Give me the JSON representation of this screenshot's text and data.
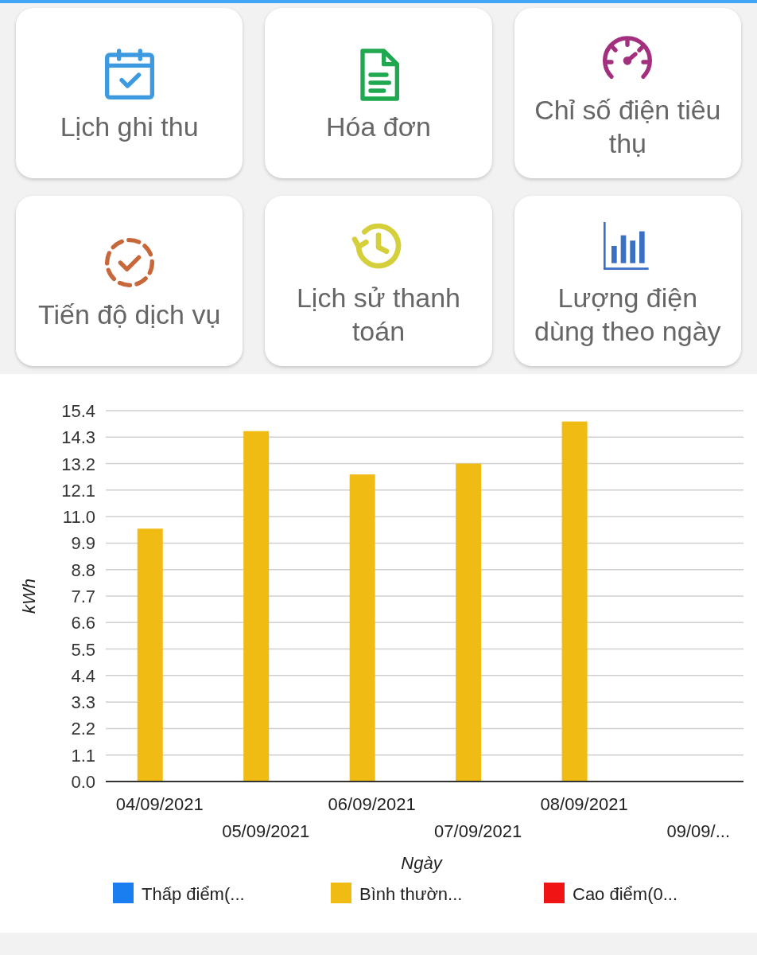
{
  "tiles": [
    {
      "label": "Lịch ghi thu",
      "kind": "calendar",
      "color": "#3d9ae0"
    },
    {
      "label": "Hóa đơn",
      "kind": "document",
      "color": "#1fa84f"
    },
    {
      "label": "Chỉ số điện tiêu thụ",
      "kind": "gauge",
      "color": "#a3307f"
    },
    {
      "label": "Tiến độ dịch vụ",
      "kind": "progress",
      "color": "#c7683a"
    },
    {
      "label": "Lịch sử thanh toán",
      "kind": "history",
      "color": "#d4cf3a"
    },
    {
      "label": "Lượng điện dùng theo ngày",
      "kind": "chart",
      "color": "#3a6fc4"
    }
  ],
  "usage": {
    "chart_data": {
      "type": "bar",
      "grid": true,
      "xlabel": "Ngày",
      "ylabel": "kWh",
      "categories": [
        "04/09/2021",
        "05/09/2021",
        "06/09/2021",
        "07/09/2021",
        "08/09/2021",
        "09/09/..."
      ],
      "ylim": [
        0,
        15.4
      ],
      "yticks": [
        {
          "value": 0,
          "label": "0.0"
        },
        {
          "value": 1.1,
          "label": "1.1"
        },
        {
          "value": 2.2,
          "label": "2.2"
        },
        {
          "value": 3.3,
          "label": "3.3"
        },
        {
          "value": 4.4,
          "label": "4.4"
        },
        {
          "value": 5.5,
          "label": "5.5"
        },
        {
          "value": 6.6,
          "label": "6.6"
        },
        {
          "value": 7.7,
          "label": "7.7"
        },
        {
          "value": 8.8,
          "label": "8.8"
        },
        {
          "value": 9.9,
          "label": "9.9"
        },
        {
          "value": 11,
          "label": "11.0"
        },
        {
          "value": 12.1,
          "label": "12.1"
        },
        {
          "value": 13.2,
          "label": "13.2"
        },
        {
          "value": 14.3,
          "label": "14.3"
        },
        {
          "value": 15.4,
          "label": "15.4"
        }
      ],
      "series": [
        {
          "name": "Thấp điểm(...",
          "color": "#1a7ef0",
          "values": [
            null,
            null,
            null,
            null,
            null,
            null
          ]
        },
        {
          "name": "Bình thườn...",
          "color": "#f0bb12",
          "values": [
            10.5,
            14.55,
            12.75,
            13.2,
            14.95,
            null
          ]
        },
        {
          "name": "Cao điểm(0...",
          "color": "#f01414",
          "values": [
            null,
            null,
            null,
            null,
            null,
            null
          ]
        }
      ]
    }
  }
}
